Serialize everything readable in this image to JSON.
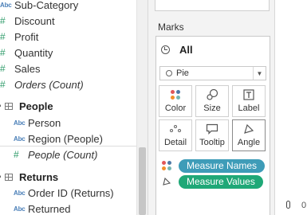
{
  "data_pane": {
    "orders_fields": [
      {
        "type": "dimension",
        "name": "Sub-Category",
        "italic": false
      },
      {
        "type": "measure",
        "name": "Discount",
        "italic": false
      },
      {
        "type": "measure",
        "name": "Profit",
        "italic": false
      },
      {
        "type": "measure",
        "name": "Quantity",
        "italic": false
      },
      {
        "type": "measure",
        "name": "Sales",
        "italic": false
      },
      {
        "type": "measure",
        "name": "Orders (Count)",
        "italic": true
      }
    ],
    "people": {
      "title": "People",
      "fields": [
        {
          "type": "dimension",
          "name": "Person"
        },
        {
          "type": "dimension",
          "name": "Region (People)"
        },
        {
          "type": "measure",
          "name": "People (Count)",
          "italic": true
        }
      ]
    },
    "returns": {
      "title": "Returns",
      "fields": [
        {
          "type": "dimension",
          "name": "Order ID (Returns)"
        },
        {
          "type": "dimension",
          "name": "Returned"
        }
      ]
    },
    "icons": {
      "dimension": "Abc",
      "measure": "#"
    }
  },
  "marks": {
    "title": "Marks",
    "all_label": "All",
    "mark_type": "Pie",
    "buttons": [
      {
        "name": "color",
        "label": "Color"
      },
      {
        "name": "size",
        "label": "Size"
      },
      {
        "name": "label",
        "label": "Label"
      },
      {
        "name": "detail",
        "label": "Detail"
      },
      {
        "name": "tooltip",
        "label": "Tooltip"
      },
      {
        "name": "angle",
        "label": "Angle"
      }
    ],
    "pills": [
      {
        "label": "Measure Names",
        "color": "#3e9cb8",
        "icon": "color-dots-icon"
      },
      {
        "label": "Measure Values",
        "color": "#1fa877",
        "icon": "angle-icon"
      }
    ]
  },
  "view": {
    "axis_value": "0"
  },
  "colors": {
    "dimension_blue": "#4a7fb8",
    "measure_green": "#2f9c6a",
    "dot_red": "#e15759",
    "dot_blue": "#4e79a7",
    "dot_orange": "#f28e2b",
    "dot_teal": "#76b7b2"
  }
}
